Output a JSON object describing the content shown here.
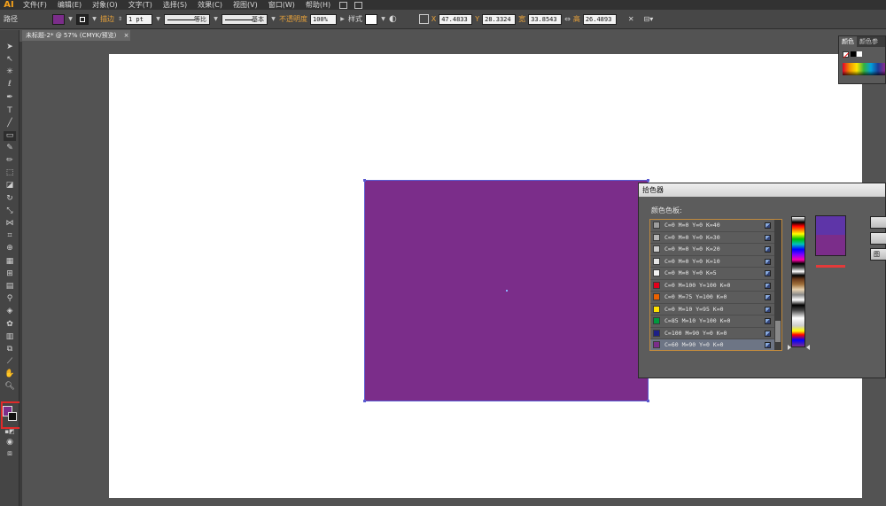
{
  "app": {
    "logo": "AI"
  },
  "menu": [
    "文件(F)",
    "编辑(E)",
    "对象(O)",
    "文字(T)",
    "选择(S)",
    "效果(C)",
    "视图(V)",
    "窗口(W)",
    "帮助(H)"
  ],
  "control_bar": {
    "object_type": "路径",
    "stroke_label": "描边",
    "stroke_weight": "1 pt",
    "stroke_profile": "等比",
    "brush": "基本",
    "opacity_label": "不透明度",
    "opacity_value": "100%",
    "style_label": "样式",
    "x_label": "X",
    "x_value": "47.4833",
    "y_label": "Y",
    "y_value": "28.3324",
    "w_label": "宽",
    "w_value": "33.8543",
    "h_label": "高",
    "h_value": "26.4893",
    "fill_color": "#7b2d8a",
    "stroke_color": "#111111"
  },
  "document_tab": {
    "title": "未标题-2* @ 57% (CMYK/预览)",
    "close": "×"
  },
  "artwork": {
    "rect_fill": "#7b2d8a",
    "rect_edge": "#5a5ad0"
  },
  "color_panel": {
    "tabs": [
      "颜色",
      "颜色参"
    ]
  },
  "picker": {
    "title": "拾色器",
    "swatch_label": "颜色色板:",
    "swatches": [
      {
        "name": "C=0 M=0 Y=0 K=40",
        "color": "#9d9d9d"
      },
      {
        "name": "C=0 M=0 Y=0 K=30",
        "color": "#b5b5b5"
      },
      {
        "name": "C=0 M=0 Y=0 K=20",
        "color": "#cccccc"
      },
      {
        "name": "C=0 M=0 Y=0 K=10",
        "color": "#e5e5e5"
      },
      {
        "name": "C=0 M=0 Y=0 K=5",
        "color": "#f2f2f2"
      },
      {
        "name": "C=0 M=100 Y=100 K=0",
        "color": "#e3001b"
      },
      {
        "name": "C=0 M=75 Y=100 K=0",
        "color": "#eb6100"
      },
      {
        "name": "C=0 M=10 Y=95 K=0",
        "color": "#ffe100"
      },
      {
        "name": "C=85 M=10 Y=100 K=0",
        "color": "#009a3e"
      },
      {
        "name": "C=100 M=90 Y=0 K=0",
        "color": "#1d2088"
      },
      {
        "name": "C=60 M=90 Y=0 K=0",
        "color": "#7b2d8a"
      }
    ],
    "selected_index": 10,
    "preview_new": "#5e35a8",
    "preview_old": "#7b2d8a",
    "buttons": [
      "",
      "",
      "图"
    ]
  }
}
